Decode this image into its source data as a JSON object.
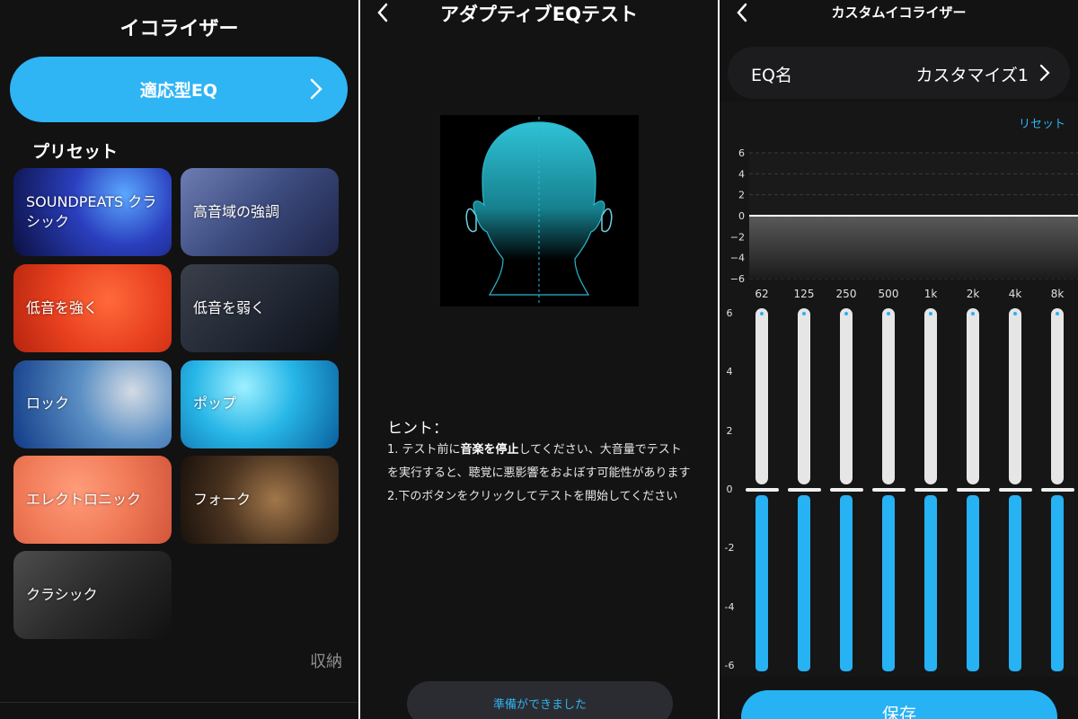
{
  "colors": {
    "accent": "#2fb4f4",
    "background": "#121212",
    "slider_upper": "#e6e6e6",
    "slider_lower": "#27b2f4",
    "muted": "#8f8f8f"
  },
  "panel1": {
    "title": "イコライザー",
    "adaptive_label": "適応型EQ",
    "preset_heading": "プリセット",
    "presets": [
      {
        "label": "SOUNDPEATS クラシック"
      },
      {
        "label": "高音域の強調"
      },
      {
        "label": "低音を強く"
      },
      {
        "label": "低音を弱く"
      },
      {
        "label": "ロック"
      },
      {
        "label": "ポップ"
      },
      {
        "label": "エレクトロニック"
      },
      {
        "label": "フォーク"
      },
      {
        "label": "クラシック"
      }
    ],
    "store_label": "収納"
  },
  "panel2": {
    "title": "アダプティブEQテスト",
    "hint_heading": "ヒント：",
    "hint1_a": "1. テスト前に",
    "hint1_b": "音楽を停止",
    "hint1_c": "してください、大音量でテストを実行すると、聴覚に悪影響をおよぼす可能性があります",
    "hint2": "2.下のボタンをクリックしてテストを開始してください",
    "ready_label": "準備ができました"
  },
  "panel3": {
    "title": "カスタムイコライザー",
    "eq_name_label": "EQ名",
    "eq_name_value": "カスタマイズ1",
    "reset_label": "リセット",
    "curve_ticks": [
      "6",
      "4",
      "2",
      "0",
      "−2",
      "−4",
      "−6"
    ],
    "slider_ticks": [
      "6",
      "4",
      "2",
      "0",
      "-2",
      "-4",
      "-6"
    ],
    "bands": [
      {
        "freq": "62",
        "gain": 0
      },
      {
        "freq": "125",
        "gain": 0
      },
      {
        "freq": "250",
        "gain": 0
      },
      {
        "freq": "500",
        "gain": 0
      },
      {
        "freq": "1k",
        "gain": 0
      },
      {
        "freq": "2k",
        "gain": 0
      },
      {
        "freq": "4k",
        "gain": 0
      },
      {
        "freq": "8k",
        "gain": 0
      }
    ],
    "save_label": "保存"
  }
}
